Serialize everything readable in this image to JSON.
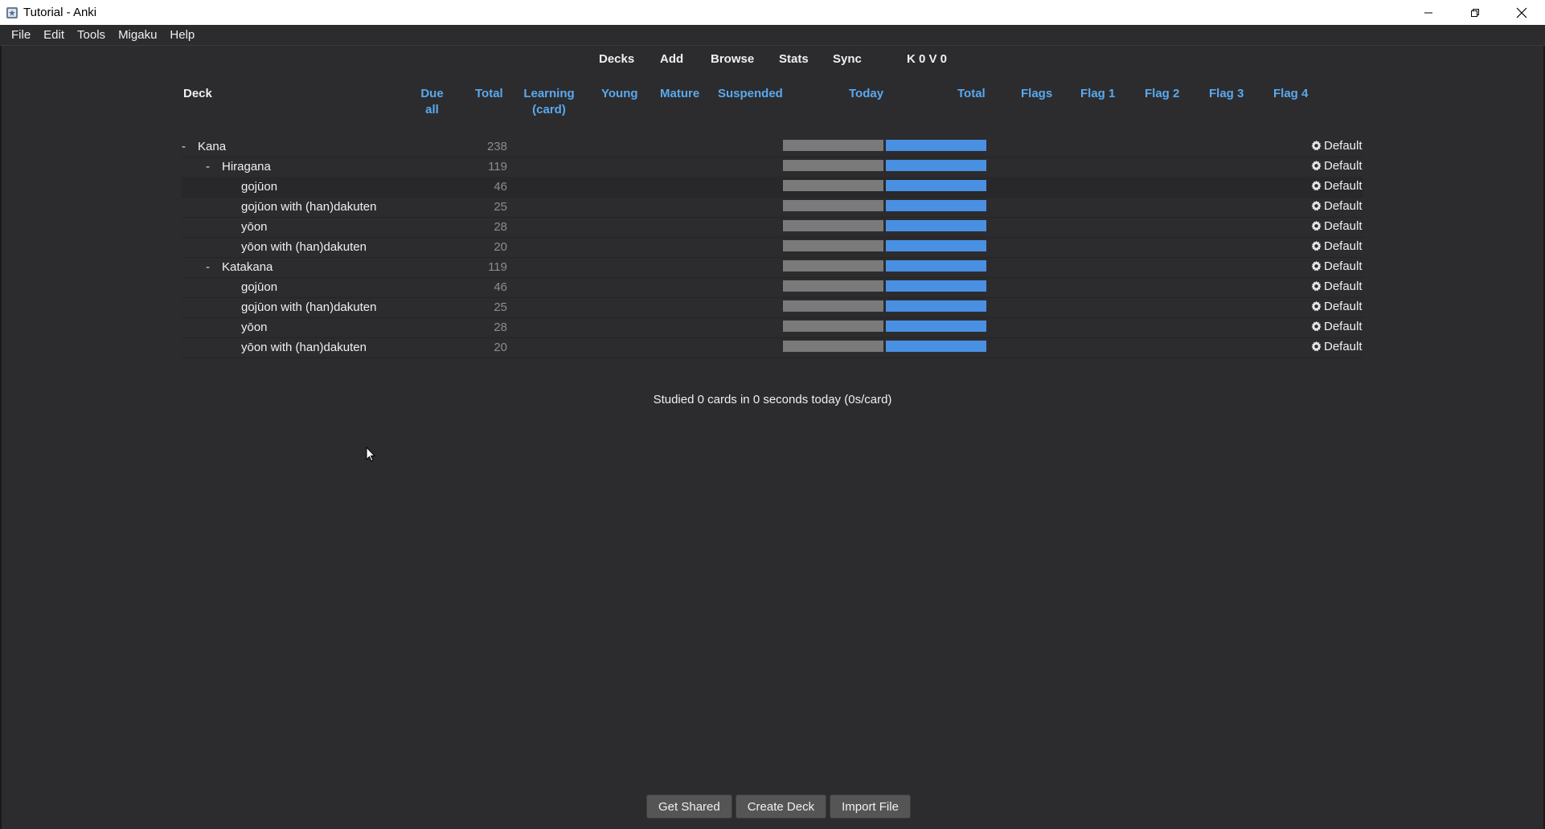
{
  "window": {
    "title": "Tutorial - Anki"
  },
  "menu": [
    {
      "label": "File"
    },
    {
      "label": "Edit"
    },
    {
      "label": "Tools"
    },
    {
      "label": "Migaku"
    },
    {
      "label": "Help"
    }
  ],
  "toolbar": {
    "decks": "Decks",
    "add": "Add",
    "browse": "Browse",
    "stats": "Stats",
    "sync": "Sync",
    "kv": "K 0 V 0"
  },
  "columns": {
    "deck": "Deck",
    "due_line1": "Due",
    "due_line2": "all",
    "total": "Total",
    "learning_line1": "Learning",
    "learning_line2": "(card)",
    "young": "Young",
    "mature": "Mature",
    "suspended": "Suspended",
    "today": "Today",
    "total2": "Total",
    "flags": "Flags",
    "flag1": "Flag 1",
    "flag2": "Flag 2",
    "flag3": "Flag 3",
    "flag4": "Flag 4"
  },
  "decks": [
    {
      "expander": "-",
      "name": "Kana",
      "total": "238",
      "options": "Default"
    },
    {
      "expander": "-",
      "name": "Hiragana",
      "total": "119",
      "options": "Default"
    },
    {
      "expander": "",
      "name": "gojūon",
      "total": "46",
      "options": "Default"
    },
    {
      "expander": "",
      "name": "gojūon with (han)dakuten",
      "total": "25",
      "options": "Default"
    },
    {
      "expander": "",
      "name": "yōon",
      "total": "28",
      "options": "Default"
    },
    {
      "expander": "",
      "name": "yōon with (han)dakuten",
      "total": "20",
      "options": "Default"
    },
    {
      "expander": "-",
      "name": "Katakana",
      "total": "119",
      "options": "Default"
    },
    {
      "expander": "",
      "name": "gojūon",
      "total": "46",
      "options": "Default"
    },
    {
      "expander": "",
      "name": "gojūon with (han)dakuten",
      "total": "25",
      "options": "Default"
    },
    {
      "expander": "",
      "name": "yōon",
      "total": "28",
      "options": "Default"
    },
    {
      "expander": "",
      "name": "yōon with (han)dakuten",
      "total": "20",
      "options": "Default"
    }
  ],
  "studied": "Studied 0 cards in 0 seconds today (0s/card)",
  "buttons": {
    "get_shared": "Get Shared",
    "create_deck": "Create Deck",
    "import_file": "Import File"
  },
  "colors": {
    "background": "#2c2c2e",
    "header_blue": "#5aa9ef",
    "bar_gray": "#7a7a7a",
    "bar_blue": "#4a90e2"
  }
}
